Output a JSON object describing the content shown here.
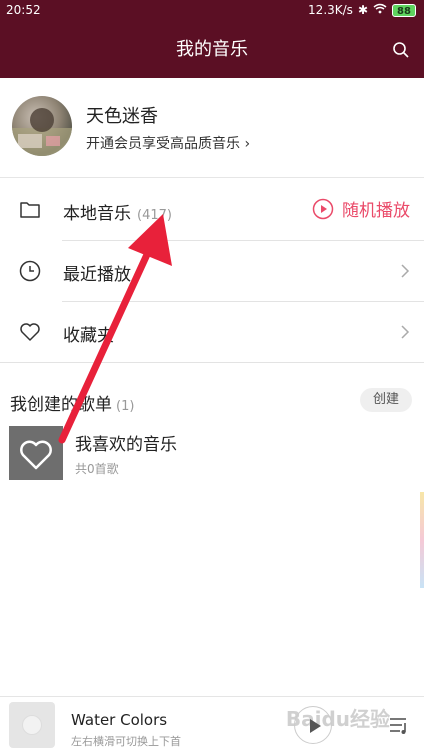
{
  "statusbar": {
    "time": "20:52",
    "network_speed": "12.3K/s",
    "battery": "88"
  },
  "header": {
    "title": "我的音乐"
  },
  "profile": {
    "username": "天色迷香",
    "vip_link": "开通会员享受高品质音乐 ›"
  },
  "library": [
    {
      "label": "本地音乐",
      "count": "(417)"
    },
    {
      "label": "最近播放"
    },
    {
      "label": "收藏夹"
    }
  ],
  "shuffle": {
    "label": "随机播放"
  },
  "playlists_section": {
    "title": "我创建的歌单",
    "count": "(1)",
    "create_label": "创建"
  },
  "playlist": {
    "name": "我喜欢的音乐",
    "sub": "共0首歌"
  },
  "player": {
    "song_title": "Water Colors",
    "hint": "左右横滑可切换上下首",
    "watermark": "Baidu经验"
  },
  "colors": {
    "header": "#5b0f24",
    "accent": "#ea4a69",
    "annotation_arrow": "#e8213a"
  },
  "icons": [
    "search-icon",
    "folder-icon",
    "play-circle-icon",
    "clock-icon",
    "heart-icon",
    "chevron-right-icon",
    "play-icon",
    "playlist-icon"
  ]
}
